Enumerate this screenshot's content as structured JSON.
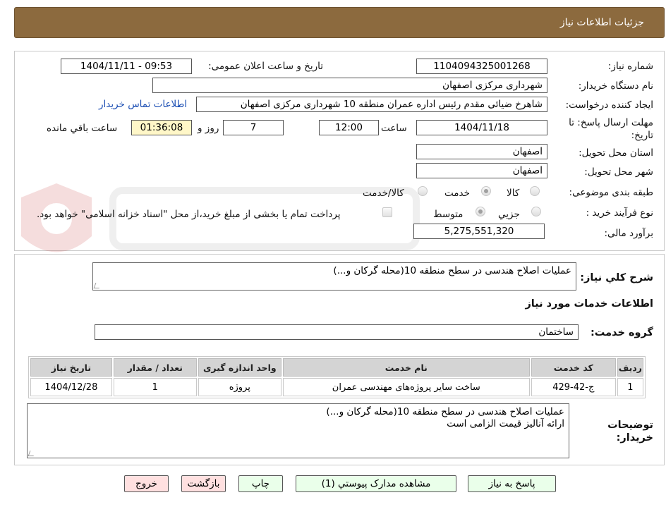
{
  "header": {
    "title": "جزئیات اطلاعات نیاز"
  },
  "form": {
    "need_number_label": "شماره نیاز:",
    "need_number": "1104094325001268",
    "announce_label": "تاریخ و ساعت اعلان عمومی:",
    "announce_value": "1404/11/11 - 09:53",
    "buyer_org_label": "نام دستگاه خریدار:",
    "buyer_org": "شهرداری مرکزی اصفهان",
    "creator_label": "ایجاد کننده درخواست:",
    "creator": "شاهرخ ضیائی مقدم رئیس اداره عمران منطقه 10 شهرداری مرکزی اصفهان",
    "contact_link": "اطلاعات تماس خریدار",
    "deadline_label_1": "مهلت ارسال پاسخ: تا",
    "deadline_label_2": "تاریخ:",
    "deadline_date": "1404/11/18",
    "time_label": "ساعت",
    "deadline_time": "12:00",
    "days_value": "7",
    "days_label": "روز و",
    "remaining_time": "01:36:08",
    "remaining_label": "ساعت باقي مانده",
    "province_label": "استان محل تحویل:",
    "province": "اصفهان",
    "city_label": "شهر محل تحویل:",
    "city": "اصفهان",
    "category_label": "طبقه بندی موضوعی:",
    "category_options": [
      "کالا",
      "خدمت",
      "کالا/خدمت"
    ],
    "category_selected": "خدمت",
    "process_label": "نوع فرآیند خرید :",
    "process_options": [
      "جزیي",
      "متوسط"
    ],
    "process_selected": "متوسط",
    "payment_note": "پرداخت تمام یا بخشی از مبلغ خرید،از محل \"اسناد خزانه اسلامی\" خواهد بود.",
    "budget_label": "برآورد مالی:",
    "budget": "5,275,551,320"
  },
  "description": {
    "label": "شرح کلي نیاز:",
    "value": "عملیات اصلاح هندسی در سطح منطقه 10(محله گرکان و...)"
  },
  "services": {
    "title": "اطلاعات خدمات مورد نیاز",
    "group_label": "گروه خدمت:",
    "group_value": "ساختمان",
    "columns": [
      "ردیف",
      "کد خدمت",
      "نام خدمت",
      "واحد اندازه گیری",
      "تعداد / مقدار",
      "تاریخ نیاز"
    ],
    "rows": [
      [
        "1",
        "ج-42-429",
        "ساخت سایر پروژه‌های مهندسی عمران",
        "پروژه",
        "1",
        "1404/12/28"
      ]
    ]
  },
  "buyer_notes": {
    "label_1": "توضیحات",
    "label_2": "خریدار:",
    "line_1": "عملیات اصلاح هندسی در سطح منطقه 10(محله گرکان و...)",
    "line_2": "ارائه آنالیز قیمت الزامی است"
  },
  "buttons": {
    "reply": "پاسخ به نیاز",
    "attachments": "مشاهده مدارک پیوستي (1)",
    "print": "چاپ",
    "back": "بازگشت",
    "exit": "خروج"
  },
  "colors": {
    "header": "#8c6a3e",
    "timer_bg": "#fff7c8",
    "link": "#1a4db3",
    "btn_green": "#eaffea",
    "btn_red": "#ffe0e0"
  }
}
